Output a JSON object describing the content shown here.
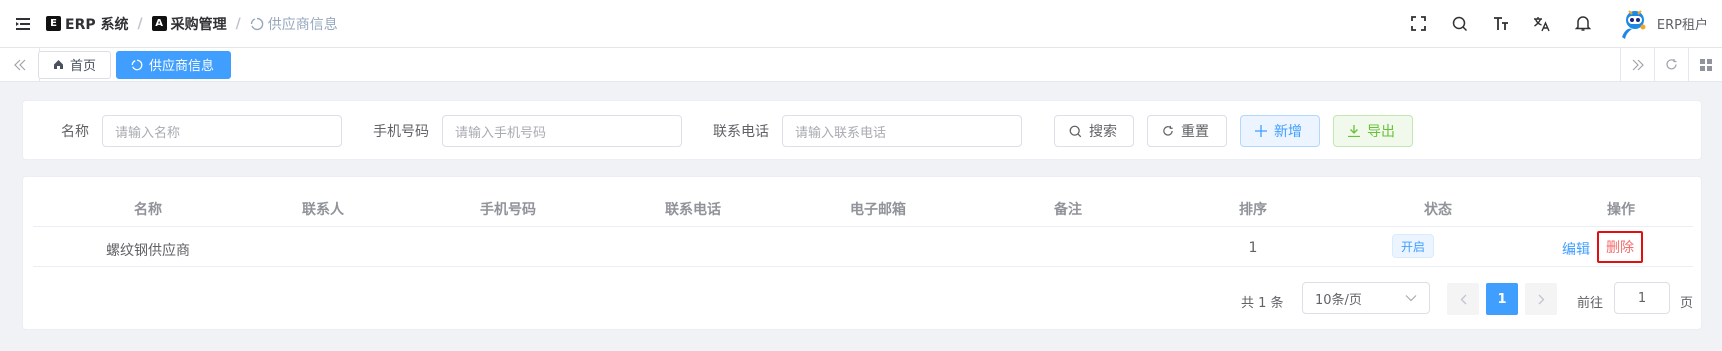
{
  "header": {
    "breadcrumb": [
      {
        "label": "ERP 系统",
        "icon": "erp-logo-icon"
      },
      {
        "label": "采购管理",
        "icon": "purchase-logo-icon"
      },
      {
        "label": "供应商信息",
        "icon": "loading-icon"
      }
    ],
    "user_name": "ERP租户",
    "icons": [
      "fullscreen-icon",
      "search-icon",
      "font-size-icon",
      "translate-icon",
      "bell-icon"
    ]
  },
  "tags": {
    "items": [
      {
        "label": "首页",
        "icon": "home-icon",
        "active": false
      },
      {
        "label": "供应商信息",
        "icon": "loading-icon",
        "active": true
      }
    ]
  },
  "search": {
    "fields": [
      {
        "label": "名称",
        "placeholder": "请输入名称"
      },
      {
        "label": "手机号码",
        "placeholder": "请输入手机号码"
      },
      {
        "label": "联系电话",
        "placeholder": "请输入联系电话"
      }
    ],
    "buttons": {
      "search": "搜索",
      "reset": "重置",
      "add": "新增",
      "export": "导出"
    }
  },
  "table": {
    "columns": [
      "名称",
      "联系人",
      "手机号码",
      "联系电话",
      "电子邮箱",
      "备注",
      "排序",
      "状态",
      "操作"
    ],
    "rows": [
      {
        "name": "螺纹钢供应商",
        "contact": "",
        "mobile": "",
        "phone": "",
        "email": "",
        "remark": "",
        "sort": "1",
        "status": "开启",
        "actions": {
          "edit": "编辑",
          "delete": "删除"
        }
      }
    ]
  },
  "pagination": {
    "total": "共 1 条",
    "page_size": "10条/页",
    "current_page": "1",
    "goto_label": "前往",
    "goto_value": "1",
    "page_suffix": "页"
  },
  "colors": {
    "primary": "#409eff",
    "danger": "#f56c6c",
    "success": "#67c23a",
    "highlight_box": "#e01010"
  }
}
